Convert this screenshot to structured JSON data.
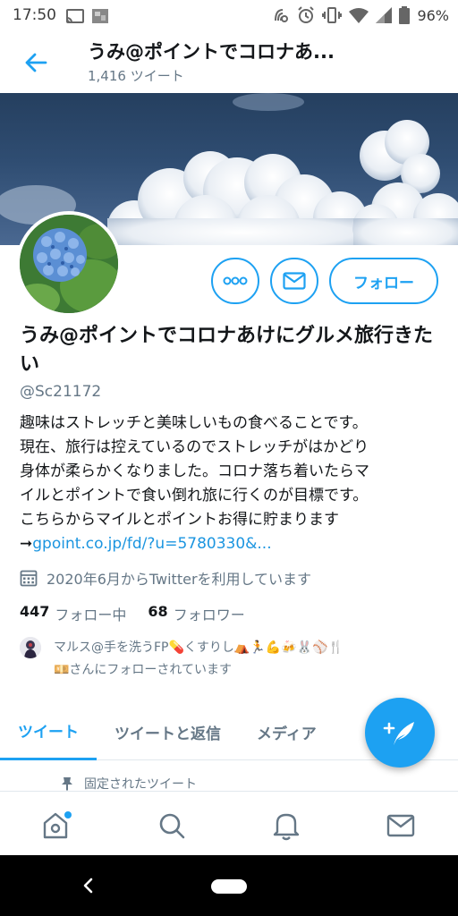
{
  "status_bar": {
    "time": "17:50",
    "battery": "96%",
    "icons": [
      "cast-icon",
      "image-icon",
      "nfc-icon",
      "alarm-icon",
      "vibrate-icon",
      "wifi-icon",
      "signal-icon",
      "battery-icon"
    ]
  },
  "header": {
    "title": "うみ@ポイントでコロナあ...",
    "subtitle": "1,416 ツイート"
  },
  "profile": {
    "display_name": "うみ@ポイントでコロナあけにグルメ旅行きたい",
    "handle": "@Sc21172",
    "bio_lines": [
      "趣味はストレッチと美味しいもの食べることです。",
      "現在、旅行は控えているのでストレッチがはかどり",
      "身体が柔らかくなりました。コロナ落ち着いたらマ",
      "イルとポイントで食い倒れ旅に行くのが目標です。",
      "こちらからマイルとポイントお得に貯まります"
    ],
    "bio_arrow": "➞",
    "bio_link": "gpoint.co.jp/fd/?u=5780330&...",
    "joined": "2020年6月からTwitterを利用しています",
    "following_count": "447",
    "following_label": "フォロー中",
    "followers_count": "68",
    "followers_label": "フォロワー",
    "followed_by_line1": "マルス@手を洗うFP💊くすりし⛺🏃💪🍻🐰⚾🍴",
    "followed_by_line2": "💴さんにフォローされています"
  },
  "actions": {
    "follow_label": "フォロー"
  },
  "tabs": [
    {
      "label": "ツイート",
      "active": true
    },
    {
      "label": "ツイートと返信",
      "active": false
    },
    {
      "label": "メディア",
      "active": false
    }
  ],
  "pinned_label": "固定されたツイート",
  "colors": {
    "accent": "#1da1f2",
    "text_primary": "#14171a",
    "text_secondary": "#657786"
  }
}
